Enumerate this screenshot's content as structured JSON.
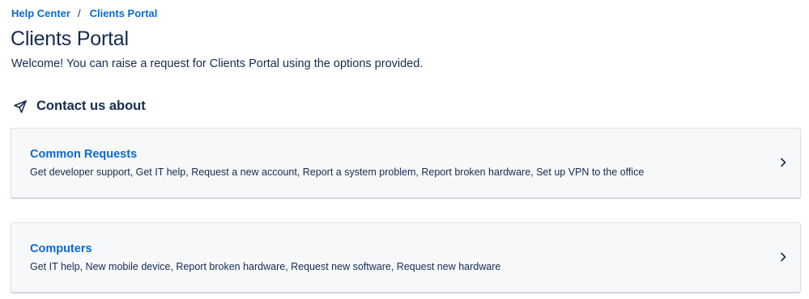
{
  "breadcrumb": {
    "home": "Help Center",
    "separator": "/",
    "current": "Clients Portal"
  },
  "page_title": "Clients Portal",
  "welcome_text": "Welcome! You can raise a request for Clients Portal using the options provided.",
  "section": {
    "icon": "send-icon",
    "heading": "Contact us about"
  },
  "cards": [
    {
      "title": "Common Requests",
      "description": "Get developer support, Get IT help, Request a new account, Report a system problem, Report broken hardware, Set up VPN to the office",
      "icon": "chevron-right-icon"
    },
    {
      "title": "Computers",
      "description": "Get IT help, New mobile device, Report broken hardware, Request new software, Request new hardware",
      "icon": "chevron-right-icon"
    }
  ],
  "colors": {
    "link": "#0b6bcb",
    "text": "#172b4d",
    "card_bg": "#f7f8fa",
    "card_border": "#dfe1e6"
  }
}
